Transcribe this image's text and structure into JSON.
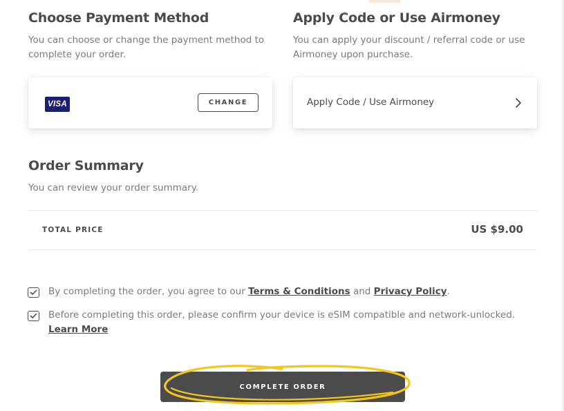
{
  "payment": {
    "title": "Choose Payment Method",
    "description": "You can choose or change the payment method to complete your order.",
    "card_brand": "VISA",
    "change_label": "CHANGE"
  },
  "code": {
    "title": "Apply Code or Use Airmoney",
    "description": "You can apply your discount / referral code or use Airmoney upon purchase.",
    "action_label": "Apply Code / Use Airmoney"
  },
  "summary": {
    "title": "Order Summary",
    "description": "You can review your order summary.",
    "total_label": "TOTAL PRICE",
    "total_value": "US $9.00"
  },
  "agreements": {
    "terms_prefix": "By completing the order, you agree to our ",
    "terms_link": "Terms & Conditions",
    "terms_and": " and ",
    "privacy_link": "Privacy Policy",
    "terms_suffix": ".",
    "terms_checked": true,
    "device_text": "Before completing this order, please confirm your device is eSIM compatible and network-unlocked.",
    "learn_more": "Learn More",
    "device_checked": true
  },
  "complete_button": "COMPLETE ORDER",
  "colors": {
    "text_dark": "#4b4b4b",
    "text_muted": "#7a7a7a",
    "visa_blue": "#1a1f71",
    "highlight": "#f5c518"
  },
  "icons": [
    "visa-card-icon",
    "chevron-right-icon",
    "check-icon"
  ]
}
